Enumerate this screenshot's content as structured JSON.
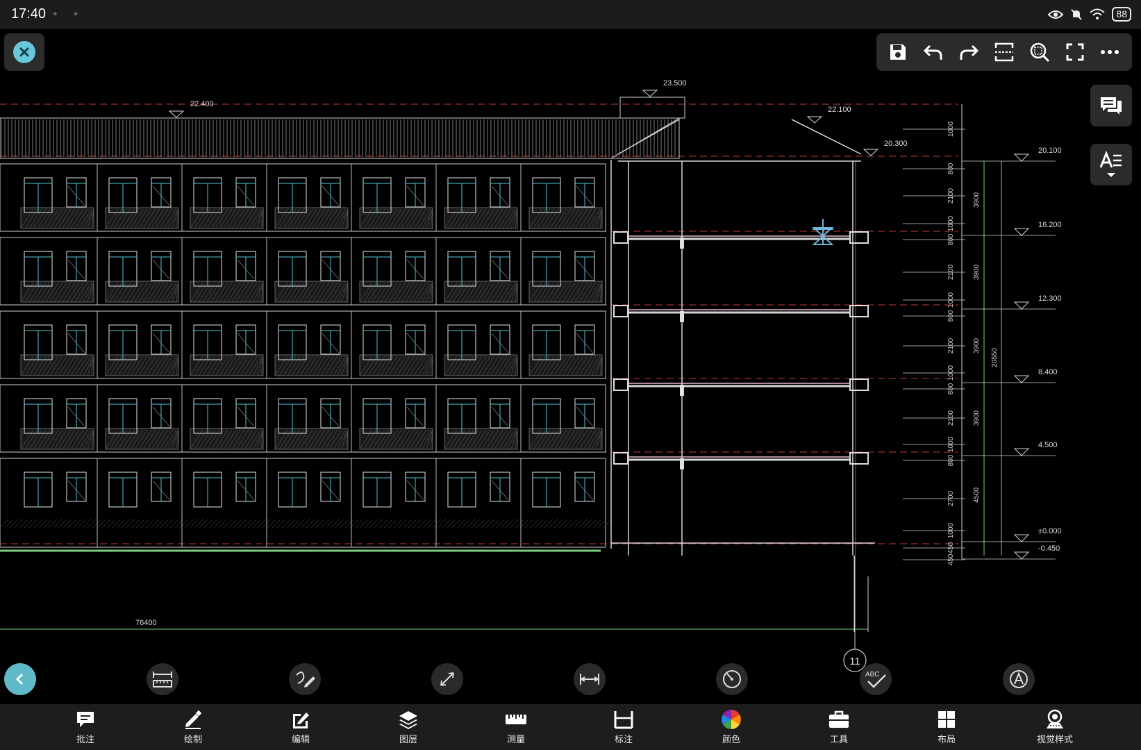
{
  "status_bar": {
    "time": "17:40",
    "battery": "88"
  },
  "drawing": {
    "elevations": {
      "roof_left": "22.400",
      "roof_top": "23.500",
      "roof_right": "22.100",
      "eave": "20.300",
      "levels": [
        "20.100",
        "16.200",
        "12.300",
        "8.400",
        "4.500",
        "±0.000",
        "-0.450"
      ]
    },
    "dims_inner": [
      "1000",
      "800",
      "2100",
      "1000",
      "800",
      "2100",
      "1000",
      "800",
      "2100",
      "1000",
      "800",
      "2100",
      "1000",
      "800",
      "2700",
      "1000",
      "450",
      "450"
    ],
    "dims_floor": [
      "3900",
      "3900",
      "3900",
      "3900",
      "4500"
    ],
    "dim_total": "20550",
    "dim_length": "76400",
    "grid_axis": "11"
  },
  "tools": {
    "labels": [
      "measure-area",
      "freehand",
      "align-measure",
      "linear-dim",
      "arc-measure",
      "spell-check",
      "text-search"
    ],
    "spell_text": "ABC"
  },
  "bottom_nav": [
    {
      "label": "批注",
      "icon": "comment-icon"
    },
    {
      "label": "绘制",
      "icon": "pencil-icon"
    },
    {
      "label": "编辑",
      "icon": "edit-icon"
    },
    {
      "label": "图层",
      "icon": "layers-icon"
    },
    {
      "label": "测量",
      "icon": "ruler-icon"
    },
    {
      "label": "标注",
      "icon": "dimension-icon"
    },
    {
      "label": "颜色",
      "icon": "color-wheel-icon"
    },
    {
      "label": "工具",
      "icon": "toolbox-icon"
    },
    {
      "label": "布局",
      "icon": "layout-icon"
    },
    {
      "label": "视觉样式",
      "icon": "visual-style-icon"
    }
  ]
}
